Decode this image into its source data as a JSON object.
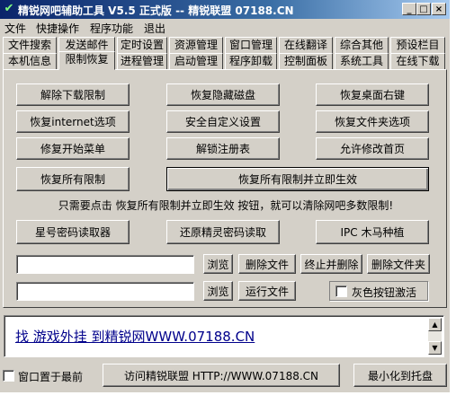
{
  "window": {
    "title": "精锐网吧辅助工具 V5.5 正式版 -- 精锐联盟 07188.CN",
    "controls": {
      "minimize": "_",
      "maximize": "□",
      "close": "×"
    }
  },
  "menu": [
    "文件",
    "快捷操作",
    "程序功能",
    "退出"
  ],
  "tabs_row1": [
    "文件搜索",
    "发送邮件",
    "定时设置",
    "资源管理",
    "窗口管理",
    "在线翻译",
    "综合其他",
    "预设栏目"
  ],
  "tabs_row2": [
    "本机信息",
    "限制恢复",
    "进程管理",
    "启动管理",
    "程序卸载",
    "控制面板",
    "系统工具",
    "在线下载"
  ],
  "active_tab": "限制恢复",
  "buttons": {
    "remove_download_limit": "解除下载限制",
    "restore_hidden_disk": "恢复隐藏磁盘",
    "restore_desktop_rightclick": "恢复桌面右键",
    "restore_internet_options": "恢复internet选项",
    "safe_custom_settings": "安全自定义设置",
    "restore_folder_options": "恢复文件夹选项",
    "repair_start_menu": "修复开始菜单",
    "unlock_registry": "解锁注册表",
    "allow_modify_homepage": "允许修改首页",
    "restore_all_limits": "恢复所有限制",
    "restore_all_and_apply": "恢复所有限制并立即生效",
    "star_password_reader": "星号密码读取器",
    "restore_jingling_password": "还原精灵密码读取",
    "ipc_trojan": "IPC 木马种植",
    "browse_1": "浏览",
    "delete_file": "删除文件",
    "terminate_and_delete": "终止并删除",
    "delete_folder": "删除文件夹",
    "browse_2": "浏览",
    "run_file": "运行文件",
    "visit_site": "访问精锐联盟  HTTP://WWW.07188.CN",
    "minimize_to_tray": "最小化到托盘"
  },
  "notice": "只需要点击 恢复所有限制并立即生效 按钮，就可以清除网吧多数限制!",
  "inputs": {
    "path1": "",
    "path2": ""
  },
  "checkboxes": {
    "gray_button_activate": {
      "label": "灰色按钮激活",
      "checked": false
    },
    "window_on_top": {
      "label": "窗口置于最前",
      "checked": false
    }
  },
  "link_text": "找 游戏外挂 到精锐网WWW.07188.CN",
  "colors": {
    "title_start": "#0a246a",
    "title_end": "#a6caf0",
    "face": "#d4d0c8",
    "link": "#00008b"
  }
}
